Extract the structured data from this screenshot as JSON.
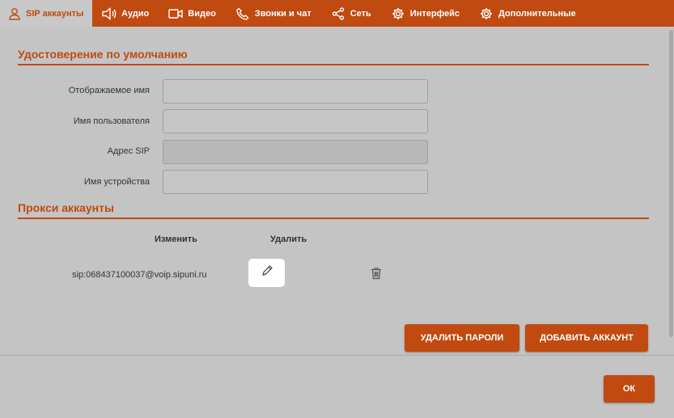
{
  "tabs": [
    {
      "label": "SIP аккаунты",
      "icon": "user-icon",
      "active": true
    },
    {
      "label": "Аудио",
      "icon": "speaker-icon"
    },
    {
      "label": "Видео",
      "icon": "video-camera-icon"
    },
    {
      "label": "Звонки и чат",
      "icon": "phone-icon"
    },
    {
      "label": "Сеть",
      "icon": "share-network-icon"
    },
    {
      "label": "Интерфейс",
      "icon": "gear-icon"
    },
    {
      "label": "Дополнительные",
      "icon": "gear-icon"
    }
  ],
  "default_identity": {
    "title": "Удостоверение по умолчанию",
    "fields": [
      {
        "label": "Отображаемое имя",
        "value": ""
      },
      {
        "label": "Имя пользователя",
        "value": ""
      },
      {
        "label": "Адрес SIP",
        "value": "",
        "disabled": true
      },
      {
        "label": "Имя устройства",
        "value": ""
      }
    ]
  },
  "proxy_accounts": {
    "title": "Прокси аккаунты",
    "col_edit": "Изменить",
    "col_delete": "Удалить",
    "accounts": [
      {
        "address": "sip:068437100037@voip.sipuni.ru"
      }
    ]
  },
  "buttons": {
    "delete_passwords": "УДАЛИТЬ ПАРОЛИ",
    "add_account": "ДОБАВИТЬ АККАУНТ",
    "ok": "ОК"
  },
  "colors": {
    "accent": "#c04a10",
    "background": "#c4c4c4"
  }
}
